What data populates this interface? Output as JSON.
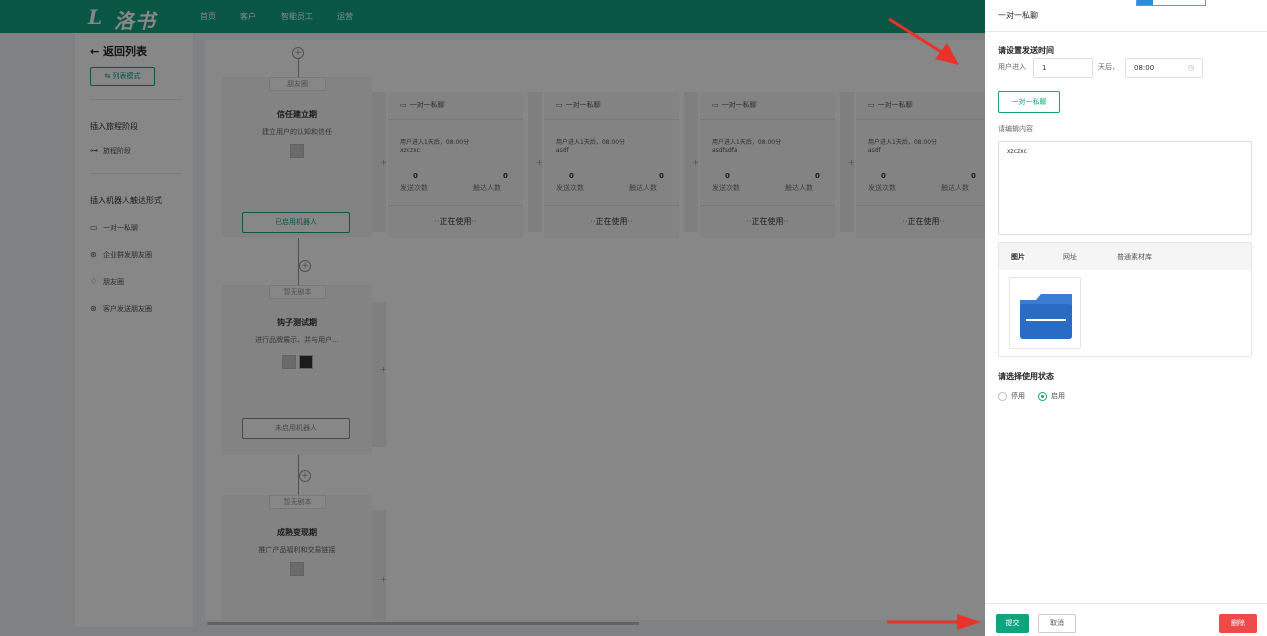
{
  "header": {
    "logo": "洛书",
    "nav": [
      "首页",
      "客户",
      "智能员工",
      "运营"
    ]
  },
  "sidebar": {
    "back": "返回列表",
    "mode": "列表模式",
    "section_node": "插入旅程阶段",
    "node_item": "旅程阶段",
    "section_robot": "插入机器人触达形式",
    "robot_items": [
      "一对一私聊",
      "企业群发朋友圈",
      "朋友圈",
      "客户发送朋友圈"
    ]
  },
  "stages": [
    {
      "tag": "朋友圈",
      "name": "信任建立期",
      "desc": "建立用户的认知和信任",
      "button": "已启用机器人"
    },
    {
      "tag": "暂无剧本",
      "name": "钩子测试期",
      "desc": "进行品牌展示、并与用户...",
      "button": "未启用机器人"
    },
    {
      "tag": "暂无剧本",
      "name": "成熟变现期",
      "desc": "推广产品福利和交易链接",
      "button": ""
    }
  ],
  "bot_cards": [
    {
      "title": "一对一私聊",
      "line1": "用户进入1天后，08:00分",
      "line2": "xzczxc",
      "sent": "0",
      "reach": "0",
      "sent_label": "发送次数",
      "reach_label": "触达人数",
      "status": "正在使用"
    },
    {
      "title": "一对一私聊",
      "line1": "用户进入1天后，08:00分",
      "line2": "asdf",
      "sent": "0",
      "reach": "0",
      "sent_label": "发送次数",
      "reach_label": "触达人数",
      "status": "正在使用"
    },
    {
      "title": "一对一私聊",
      "line1": "用户进入1天后，08:00分",
      "line2": "asdfsdfa",
      "sent": "0",
      "reach": "0",
      "sent_label": "发送次数",
      "reach_label": "触达人数",
      "status": "正在使用"
    },
    {
      "title": "一对一私聊",
      "line1": "用户进入1天后，08:00分",
      "line2": "asdf",
      "sent": "0",
      "reach": "0",
      "sent_label": "发送次数",
      "reach_label": "触达人数",
      "status": "正在使用"
    }
  ],
  "panel": {
    "title": "一对一私聊",
    "time_label": "请设置发送时间",
    "time_prefix": "用户进入",
    "days": "1",
    "days_suffix": "天后，",
    "time": "08:00",
    "type_button": "一对一私聊",
    "content_label": "请编辑内容",
    "content": "xzczxc",
    "tabs": [
      "图片",
      "网址",
      "普通素材库"
    ],
    "delete_overlay": "删除",
    "status_label": "请选择使用状态",
    "status_options": [
      "停用",
      "启用"
    ],
    "submit": "提交",
    "cancel": "取消",
    "delete": "删除"
  },
  "colors": {
    "brand": "#10a37f",
    "danger": "#ee4a4a",
    "arrow": "#e8322a"
  }
}
